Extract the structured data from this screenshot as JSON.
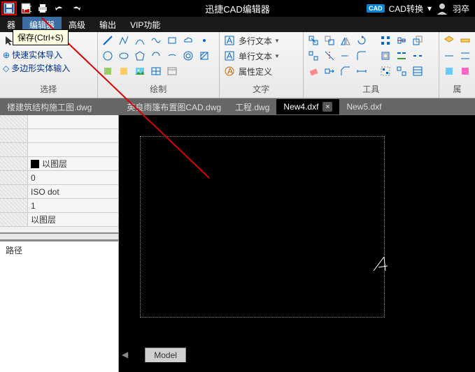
{
  "title": "迅捷CAD编辑器",
  "titlebar": {
    "convert_label": "CAD转换",
    "user": "羽卒"
  },
  "tooltip": "保存(Ctrl+S)",
  "menu": {
    "items": [
      "器",
      "编辑器",
      "高级",
      "输出",
      "VIP功能"
    ]
  },
  "ribbon": {
    "sel": {
      "label": "选择",
      "quick_import": "快速实体导入",
      "poly_import": "多边形实体输入"
    },
    "draw": {
      "label": "绘制"
    },
    "text": {
      "label": "文字",
      "mtext": "多行文本",
      "stext": "单行文本",
      "attr": "属性定义"
    },
    "tool": {
      "label": "工具"
    }
  },
  "files": {
    "f0": "楼建筑结构施工图.dwg",
    "f1": "英良雨篷布置图CAD.dwg",
    "f2": "工程.dwg",
    "f3": "New4.dxf",
    "f4": "New5.dxf"
  },
  "props": {
    "r0": "以图层",
    "r1": "0",
    "r2": "ISO dot",
    "r3": "1",
    "r4": "以图层"
  },
  "path_label": "路径",
  "model_tab": "Model"
}
